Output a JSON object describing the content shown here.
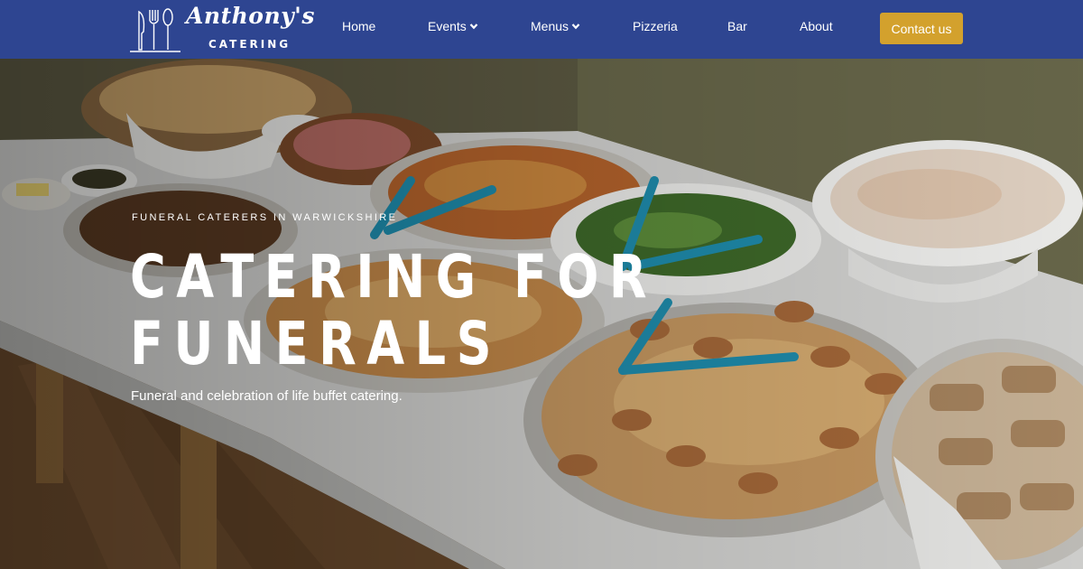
{
  "brand": {
    "script_name": "Anthony's",
    "sub_name": "CATERING",
    "icon": "cutlery-icon"
  },
  "nav": {
    "items": [
      {
        "label": "Home",
        "dropdown": false
      },
      {
        "label": "Events",
        "dropdown": true
      },
      {
        "label": "Menus",
        "dropdown": true
      },
      {
        "label": "Pizzeria",
        "dropdown": false
      },
      {
        "label": "Bar",
        "dropdown": false
      },
      {
        "label": "About",
        "dropdown": false
      }
    ],
    "cta_label": "Contact us"
  },
  "hero": {
    "eyebrow": "FUNERAL CATERERS IN WARWICKSHIRE",
    "headline_line1": "CATERING FOR",
    "headline_line2": "FUNERALS",
    "tagline": "Funeral and celebration of life buffet catering.",
    "image": "buffet-table-photo"
  },
  "colors": {
    "nav_bg": "#2e4591",
    "cta_bg": "#d3a12d",
    "text": "#ffffff"
  }
}
